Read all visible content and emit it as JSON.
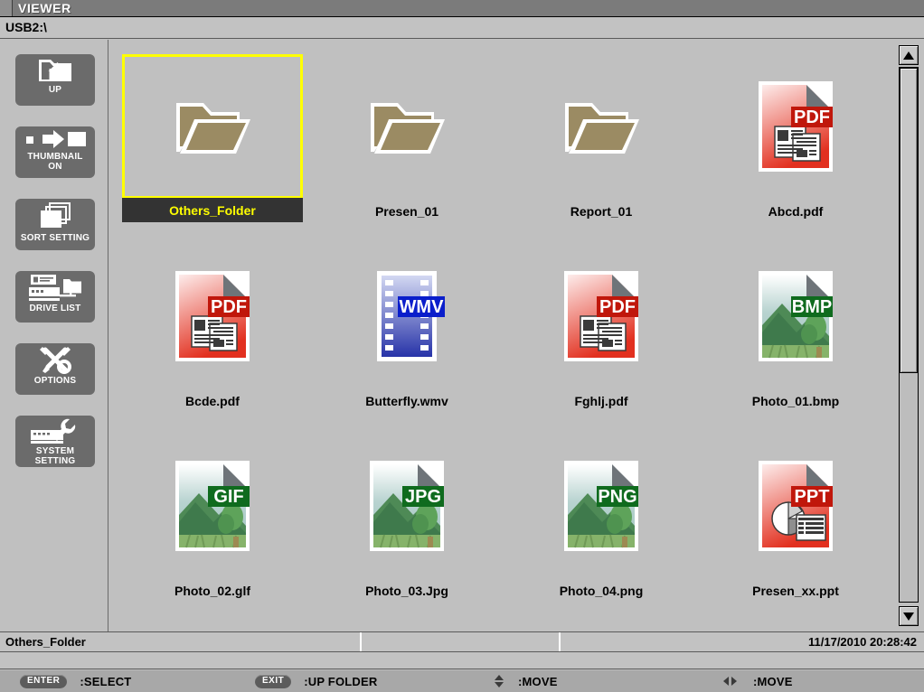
{
  "window": {
    "title": "VIEWER",
    "path": "USB2:\\"
  },
  "sidebar": {
    "buttons": [
      {
        "id": "up",
        "label": "UP",
        "icon": "folder-up-icon"
      },
      {
        "id": "thumbnail",
        "label": "THUMBNAIL\nON",
        "icon": "thumbnail-toggle-icon"
      },
      {
        "id": "sort",
        "label": "SORT SETTING",
        "icon": "stacked-pages-icon"
      },
      {
        "id": "drive",
        "label": "DRIVE LIST",
        "icon": "drive-network-icon"
      },
      {
        "id": "options",
        "label": "OPTIONS",
        "icon": "tools-icon"
      },
      {
        "id": "system",
        "label": "SYSTEM SETTING",
        "icon": "wrench-keyboard-icon"
      }
    ]
  },
  "files": [
    {
      "name": "Others_Folder",
      "kind": "folder",
      "badge": "",
      "selected": true
    },
    {
      "name": "Presen_01",
      "kind": "folder",
      "badge": "",
      "selected": false
    },
    {
      "name": "Report_01",
      "kind": "folder",
      "badge": "",
      "selected": false
    },
    {
      "name": "Abcd.pdf",
      "kind": "pdf",
      "badge": "PDF",
      "selected": false
    },
    {
      "name": "Bcde.pdf",
      "kind": "pdf",
      "badge": "PDF",
      "selected": false
    },
    {
      "name": "Butterfly.wmv",
      "kind": "video",
      "badge": "WMV",
      "selected": false
    },
    {
      "name": "Fghlj.pdf",
      "kind": "pdf",
      "badge": "PDF",
      "selected": false
    },
    {
      "name": "Photo_01.bmp",
      "kind": "image",
      "badge": "BMP",
      "selected": false
    },
    {
      "name": "Photo_02.glf",
      "kind": "image",
      "badge": "GIF",
      "selected": false
    },
    {
      "name": "Photo_03.Jpg",
      "kind": "image",
      "badge": "JPG",
      "selected": false
    },
    {
      "name": "Photo_04.png",
      "kind": "image",
      "badge": "PNG",
      "selected": false
    },
    {
      "name": "Presen_xx.ppt",
      "kind": "ppt",
      "badge": "PPT",
      "selected": false
    }
  ],
  "status": {
    "selected_name": "Others_Folder",
    "date": "11/17/2010",
    "time": "20:28:42",
    "datetime": "11/17/2010  20:28:42"
  },
  "footer": {
    "hints": [
      {
        "key": "ENTER",
        "key_type": "pill",
        "action": ":SELECT"
      },
      {
        "key": "EXIT",
        "key_type": "pill",
        "action": ":UP FOLDER"
      },
      {
        "key": "",
        "key_type": "updown",
        "action": ":MOVE"
      },
      {
        "key": "",
        "key_type": "leftright",
        "action": ":MOVE"
      }
    ]
  },
  "scrollbar": {
    "up_arrow": "triangle-up-icon",
    "down_arrow": "triangle-down-icon",
    "thumb_position_pct": 0,
    "thumb_size_pct": 57
  },
  "colors": {
    "selection": "#ffff00",
    "selection_label_bg": "#333333",
    "folder": "#9b8b63",
    "titlebar": "#7b7b7b",
    "background": "#c0c0c0",
    "pdf_red": "#e03a2a",
    "badge_red": "#c0170b",
    "badge_green": "#1a6b22",
    "badge_blue": "#0a1ecb"
  }
}
